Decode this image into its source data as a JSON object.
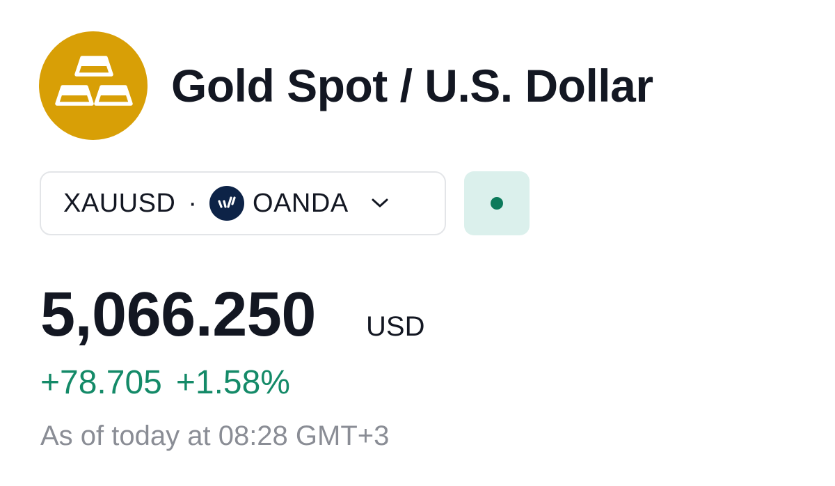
{
  "header": {
    "logo_icon": "gold-bars-icon",
    "logo_color": "#d89f06",
    "title": "Gold Spot / U.S. Dollar"
  },
  "symbol": {
    "ticker": "XAUUSD",
    "separator": "·",
    "exchange_icon": "oanda-logo-icon",
    "exchange": "OANDA",
    "dropdown_icon": "chevron-down-icon"
  },
  "status": {
    "indicator_color": "#0c7a5b",
    "icon": "market-status-dot-icon"
  },
  "quote": {
    "price": "5,066.250",
    "currency": "USD",
    "change": "+78.705",
    "change_percent": "+1.58%",
    "change_color": "#148a68",
    "as_of": "As of today at 08:28 GMT+3"
  }
}
